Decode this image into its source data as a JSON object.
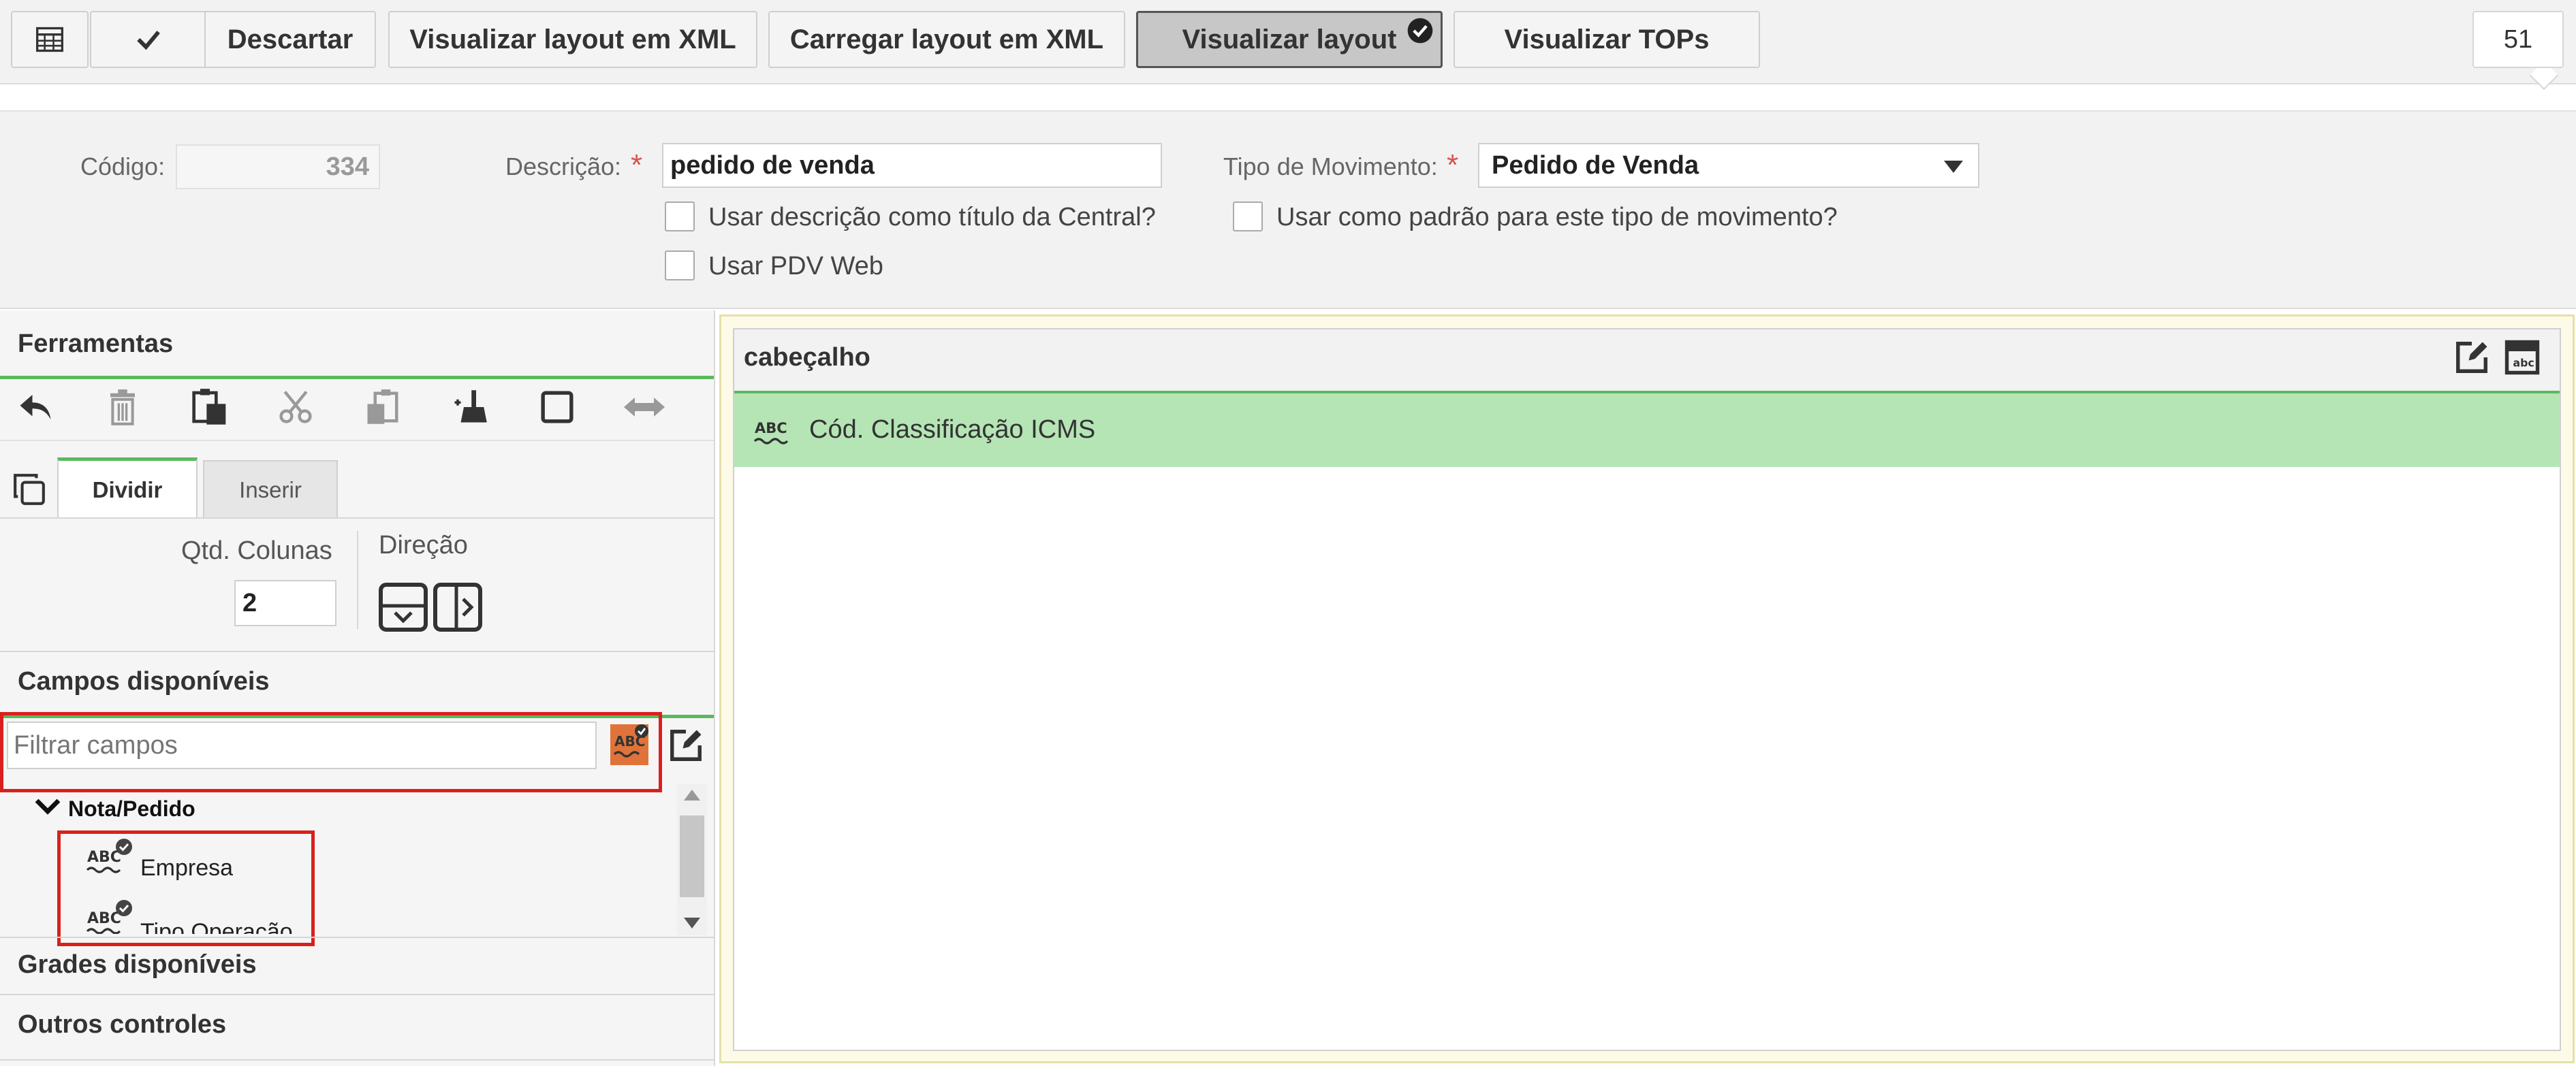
{
  "toolbar": {
    "table_button": "table-icon",
    "confirm_button": "check-icon",
    "discard_label": "Descartar",
    "view_xml_label": "Visualizar layout em XML",
    "load_xml_label": "Carregar layout em XML",
    "view_layout_label": "Visualizar layout",
    "view_tops_label": "Visualizar TOPs",
    "counter": "51"
  },
  "form": {
    "codigo_label": "Código:",
    "codigo_value": "334",
    "descricao_label": "Descrição:",
    "descricao_value": "pedido de venda",
    "tipo_mov_label": "Tipo de Movimento:",
    "tipo_mov_value": "Pedido de Venda",
    "chk_titulo_central": "Usar descrição como título da Central?",
    "chk_padrao_tipo": "Usar como padrão para este tipo de movimento?",
    "chk_pdv_web": "Usar PDV Web"
  },
  "left": {
    "ferramentas_title": "Ferramentas",
    "tabs": [
      {
        "label": "Dividir",
        "active": true
      },
      {
        "label": "Inserir",
        "active": false
      }
    ],
    "qtd_colunas_label": "Qtd. Colunas",
    "qtd_colunas_value": "2",
    "direcao_label": "Direção",
    "campos_title": "Campos disponíveis",
    "filter_placeholder": "Filtrar campos",
    "tree_group": "Nota/Pedido",
    "tree_items": [
      "Empresa",
      "Tipo Operação"
    ],
    "grades_title": "Grades disponíveis",
    "outros_title": "Outros controles"
  },
  "right": {
    "section_title": "cabeçalho",
    "field_label": "Cód. Classificação ICMS"
  },
  "colors": {
    "accent_green": "#5cb85c",
    "field_highlight": "#b5e5b5",
    "highlight_box": "#d9201c",
    "required": "#d9534f"
  }
}
